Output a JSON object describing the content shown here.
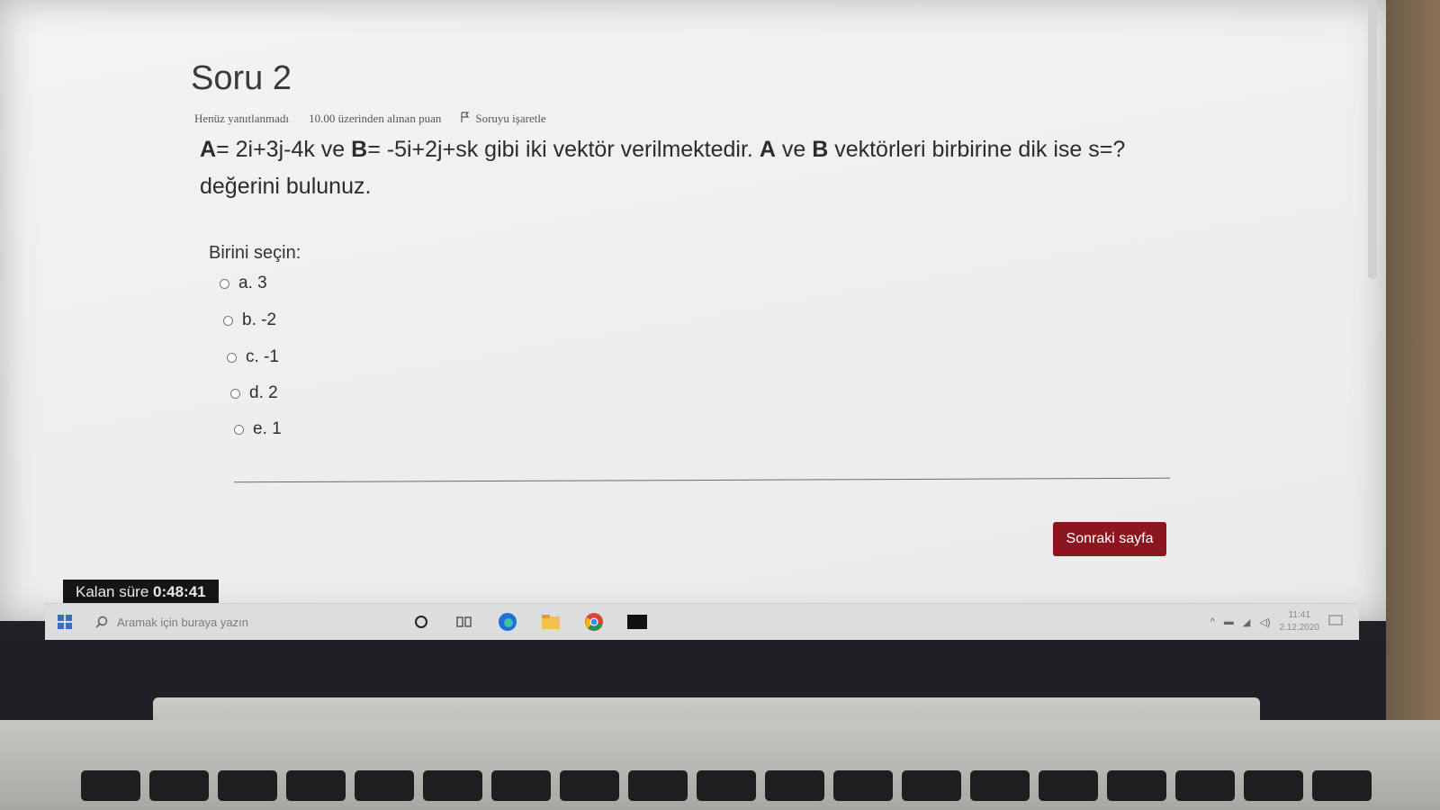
{
  "question": {
    "title": "Soru 2",
    "status": "Henüz yanıtlanmadı",
    "points": "10.00 üzerinden alınan puan",
    "flag_label": "Soruyu işaretle",
    "text_a_label": "A",
    "text_a_expr": "= 2i+3j-4k",
    "text_and": " ve ",
    "text_b_label": "B",
    "text_b_expr": "= -5i+2j+sk",
    "text_mid": " gibi iki vektör verilmektedir. ",
    "text_a2": "A",
    "text_ve2": " ve ",
    "text_b2": "B",
    "text_end": " vektörleri birbirine dik ise s=? değerini bulunuz."
  },
  "answers": {
    "prompt": "Birini seçin:",
    "options": [
      {
        "label": "a. 3"
      },
      {
        "label": "b. -2"
      },
      {
        "label": "c. -1"
      },
      {
        "label": "d. 2"
      },
      {
        "label": "e. 1"
      }
    ]
  },
  "navigation": {
    "next_label": "Sonraki sayfa"
  },
  "timer": {
    "label": "Kalan süre",
    "value": "0:48:41"
  },
  "taskbar": {
    "search_placeholder": "Aramak için buraya yazın",
    "time": "11:41",
    "date": "2.12.2020"
  },
  "colors": {
    "accent": "#8b1620",
    "timer_bg": "#151515",
    "edge_blue": "#1e6fd9"
  }
}
